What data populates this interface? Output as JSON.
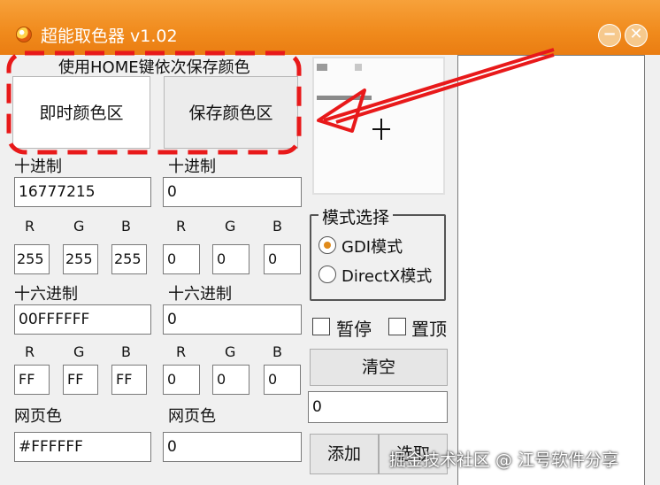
{
  "window": {
    "title": "超能取色器 v1.02",
    "minimize_symbol": "−",
    "close_symbol": "✕"
  },
  "swatches": {
    "hint": "使用HOME键依次保存颜色",
    "live_label": "即时颜色区",
    "saved_label": "保存颜色区",
    "live_color": "#ffffff",
    "saved_color": "#ececec"
  },
  "live": {
    "decimal_label": "十进制",
    "decimal_value": "16777215",
    "r_label": "R",
    "g_label": "G",
    "b_label": "B",
    "r": "255",
    "g": "255",
    "b": "255",
    "hex_label": "十六进制",
    "hex_value": "00FFFFFF",
    "hex_r_label": "R",
    "hex_g_label": "G",
    "hex_b_label": "B",
    "hex_r": "FF",
    "hex_g": "FF",
    "hex_b": "FF",
    "web_label": "网页色",
    "web_value": "#FFFFFF"
  },
  "saved": {
    "decimal_label": "十进制",
    "decimal_value": "0",
    "r_label": "R",
    "g_label": "G",
    "b_label": "B",
    "r": "0",
    "g": "0",
    "b": "0",
    "hex_label": "十六进制",
    "hex_value": "0",
    "hex_r_label": "R",
    "hex_g_label": "G",
    "hex_b_label": "B",
    "hex_r": "0",
    "hex_g": "0",
    "hex_b": "0",
    "web_label": "网页色",
    "web_value": "0"
  },
  "mode": {
    "title": "模式选择",
    "option_gdi": "GDI模式",
    "option_directx": "DirectX模式",
    "selected": "GDI模式"
  },
  "options": {
    "pause_label": "暂停",
    "topmost_label": "置顶",
    "pause_checked": false,
    "topmost_checked": false
  },
  "actions": {
    "clear_label": "清空",
    "count_value": "0",
    "add_label": "添加",
    "pick_label": "选取"
  },
  "watermark": "掘金技术社区 @ 江号软件分享",
  "colors": {
    "titlebar": "#f08a1c",
    "annotation_red": "#e8191a",
    "radio_dot": "#e08a1a"
  }
}
